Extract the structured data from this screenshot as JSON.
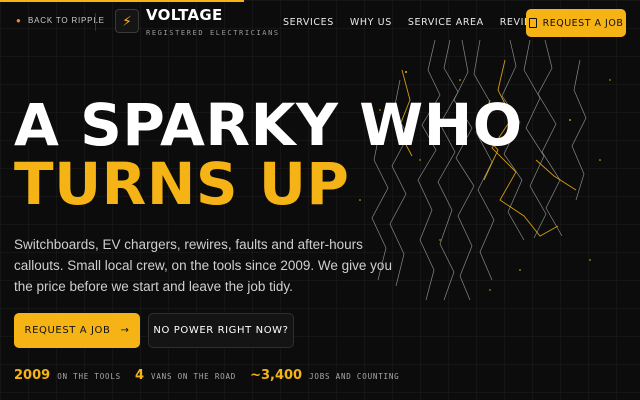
{
  "header": {
    "back_label": "BACK TO RIPPLE",
    "brand_name": "VOLTAGE",
    "brand_sub": "REGISTERED ELECTRICIANS",
    "nav": [
      "SERVICES",
      "WHY US",
      "SERVICE AREA",
      "REVIEWS"
    ],
    "cta_label": "REQUEST A JOB"
  },
  "hero": {
    "title_line1": "A SPARKY WHO",
    "title_line2": "TURNS UP",
    "description": "Switchboards, EV chargers, rewires, faults and after-hours callouts. Small local crew, on the tools since 2009. We give you the price before we start and leave the job tidy.",
    "primary_button": "REQUEST A JOB",
    "primary_arrow": "→",
    "secondary_button": "NO POWER RIGHT NOW?"
  },
  "stats": [
    {
      "value": "2009",
      "label": "ON THE TOOLS"
    },
    {
      "value": "4",
      "label": "VANS ON THE ROAD"
    },
    {
      "value": "~3,400",
      "label": "JOBS AND COUNTING"
    }
  ],
  "icons": {
    "logo": "bolt-icon",
    "back": "flame-icon",
    "doc": "document-icon"
  },
  "colors": {
    "accent": "#f5b316",
    "background": "#0c0c0d"
  }
}
